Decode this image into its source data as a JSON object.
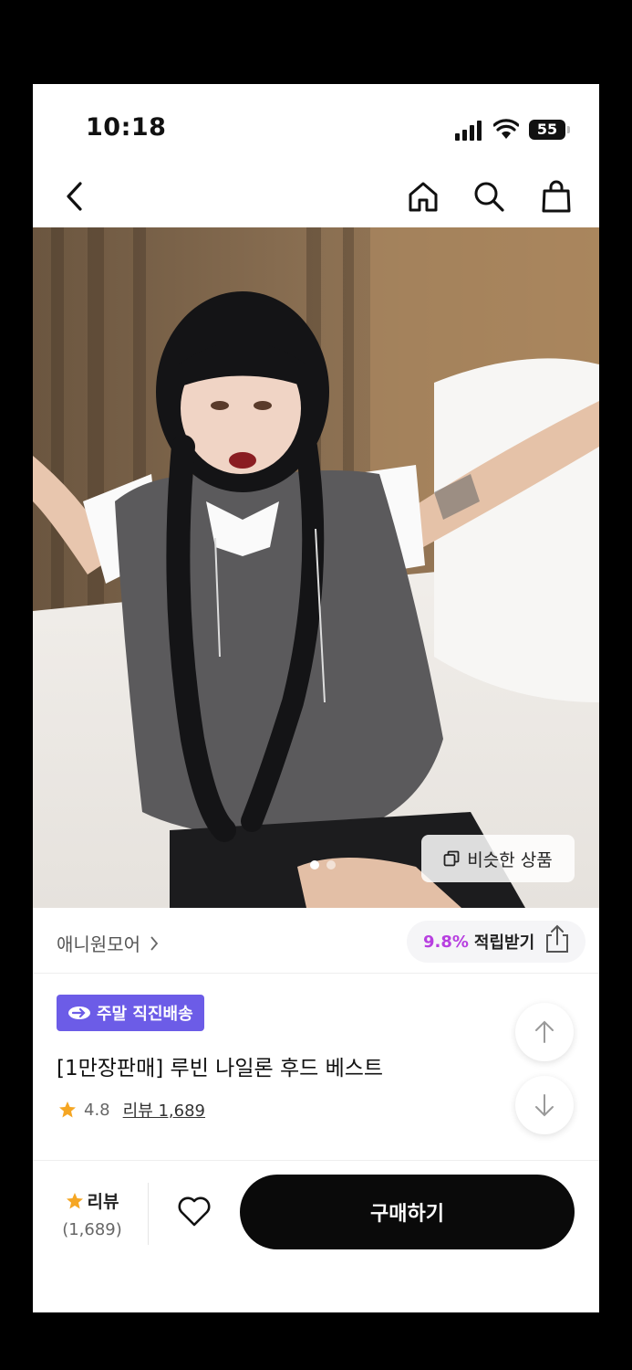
{
  "status_bar": {
    "time": "10:18",
    "battery": "55"
  },
  "nav": {
    "back_icon": "chevron-left-icon",
    "home_icon": "home-icon",
    "search_icon": "search-icon",
    "cart_icon": "shopping-bag-icon"
  },
  "gallery": {
    "similar_button_label": "비슷한 상품",
    "dot_count": 2,
    "active_dot": 0
  },
  "store": {
    "name": "애니원모어",
    "reward_percent": "9.8%",
    "reward_label": "적립받기"
  },
  "product": {
    "badge_label": "주말 직진배송",
    "title": "[1만장판매] 루빈 나일론 후드 베스트",
    "rating": "4.8",
    "review_link": "리뷰 1,689"
  },
  "bottom_bar": {
    "review_label": "리뷰",
    "review_count": "(1,689)",
    "buy_label": "구매하기"
  },
  "colors": {
    "accent_purple": "#6c5ce7",
    "reward_pink": "#b73fe0",
    "star": "#f5a623",
    "buy_button": "#0a0a0a"
  }
}
